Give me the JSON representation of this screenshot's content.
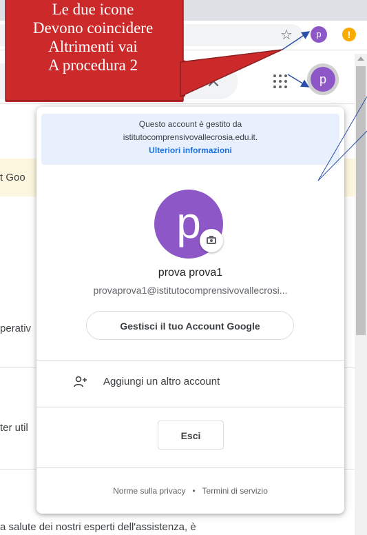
{
  "browser": {
    "star_icon": "star-icon",
    "profile_initial": "p",
    "alert_symbol": "!",
    "colors": {
      "profile": "#8e57c8",
      "alert": "#f9ab00"
    }
  },
  "page": {
    "close_symbol": "×",
    "profile_initial": "p",
    "fragments": {
      "frag1": "t Goo",
      "frag2": "perativ",
      "frag3": "ter util",
      "frag4": "a salute dei nostri esperti dell'assistenza, è"
    }
  },
  "annotation": {
    "lines": [
      "Le due icone",
      "Devono coincidere",
      "Altrimenti vai",
      "A procedura 2"
    ],
    "color": "#cc2a2a"
  },
  "popup": {
    "managed_line1": "Questo account è gestito da",
    "managed_line2": "istitutocomprensivovallecrosia.edu.it.",
    "managed_link": "Ulteriori informazioni",
    "avatar_initial": "p",
    "user_name": "prova prova1",
    "user_email": "provaprova1@istitutocomprensivovallecrosi...",
    "manage_button": "Gestisci il tuo Account Google",
    "add_account": "Aggiungi un altro account",
    "signout_button": "Esci",
    "privacy_link": "Norme sulla privacy",
    "separator": "•",
    "terms_link": "Termini di servizio"
  }
}
